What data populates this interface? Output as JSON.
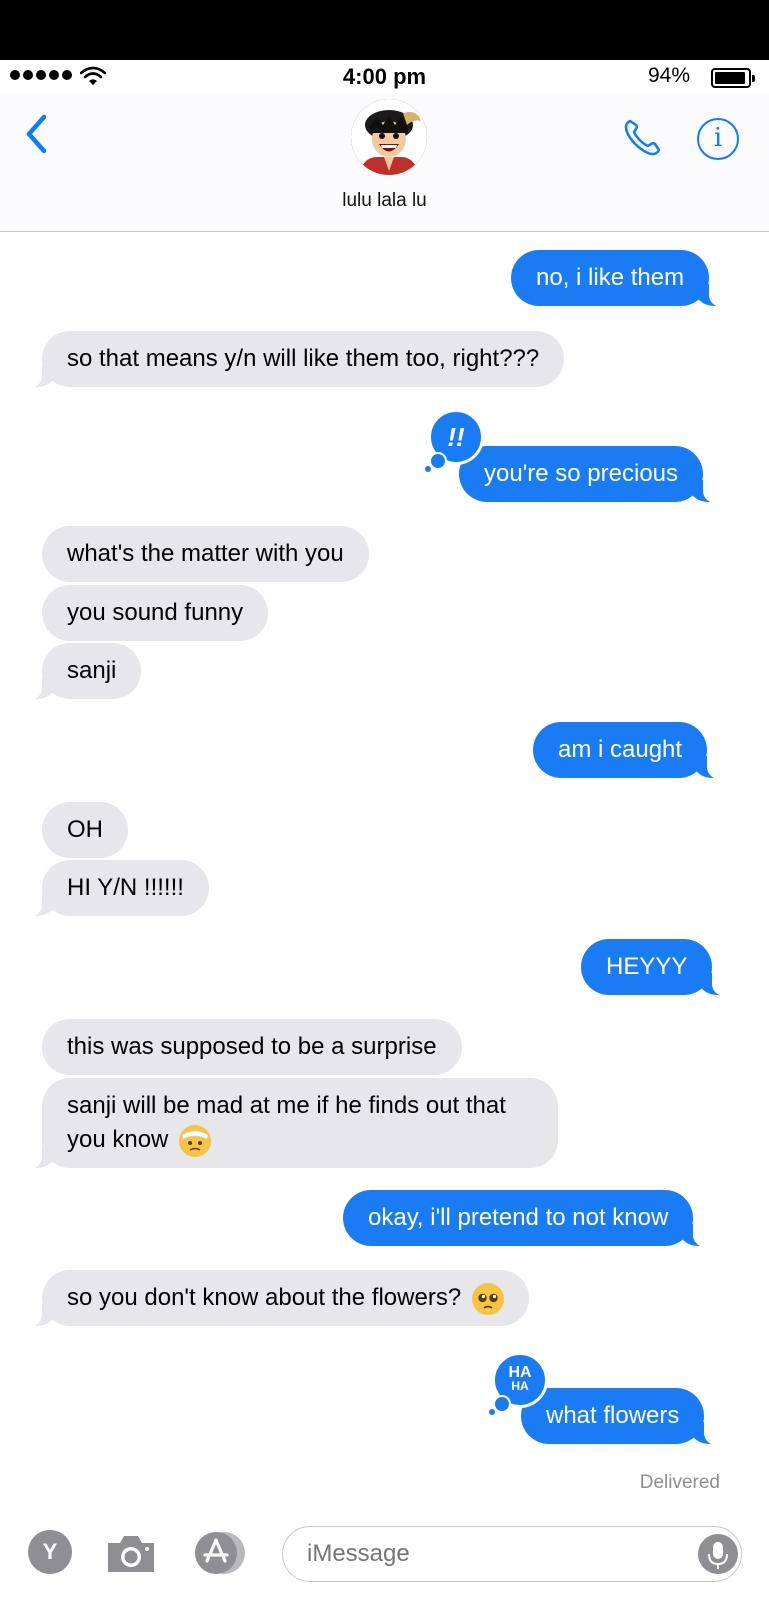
{
  "status_bar": {
    "time": "4:00 pm",
    "battery_percent": "94%",
    "signal_bars": 5,
    "battery_level": 0.94
  },
  "header": {
    "contact_name": "lulu lala lu",
    "icons": [
      "back-chevron-icon",
      "avatar",
      "phone-icon",
      "info-icon"
    ],
    "info_glyph": "i",
    "accent_color": "#0a7cff"
  },
  "messages": [
    {
      "direction": "sent",
      "text": "no, i like them"
    },
    {
      "direction": "received",
      "text": "so that means y/n will like them too, right???"
    },
    {
      "direction": "sent",
      "text": "you're so precious",
      "tapback": "!!"
    },
    {
      "direction": "received",
      "text": "what's the matter with you"
    },
    {
      "direction": "received",
      "text": "you sound funny"
    },
    {
      "direction": "received",
      "text": "sanji"
    },
    {
      "direction": "sent",
      "text": "am i caught"
    },
    {
      "direction": "received",
      "text": "OH"
    },
    {
      "direction": "received",
      "text": "HI Y/N !!!!!!"
    },
    {
      "direction": "sent",
      "text": "HEYYY"
    },
    {
      "direction": "received",
      "text": "this was supposed to be a surprise"
    },
    {
      "direction": "received",
      "text": "sanji will be mad at me if he finds out that you know",
      "emoji": "face-with-head-bandage"
    },
    {
      "direction": "sent",
      "text": "okay, i'll pretend to not know"
    },
    {
      "direction": "received",
      "text": "so you don't know about the flowers?",
      "emoji": "pleading-face"
    },
    {
      "direction": "sent",
      "text": "what flowers",
      "tapback": "HA HA",
      "tapback_lines": [
        "HA",
        "HA"
      ]
    }
  ],
  "delivery_status": "Delivered",
  "input_bar": {
    "y_button_label": "Y",
    "placeholder": "iMessage",
    "icons": [
      "y-app-icon",
      "camera-icon",
      "app-store-icon",
      "microphone-icon"
    ]
  },
  "colors": {
    "sent_bubble": "#1a7cf5",
    "received_bubble": "#e6e6eb",
    "background": "#ffffff"
  }
}
